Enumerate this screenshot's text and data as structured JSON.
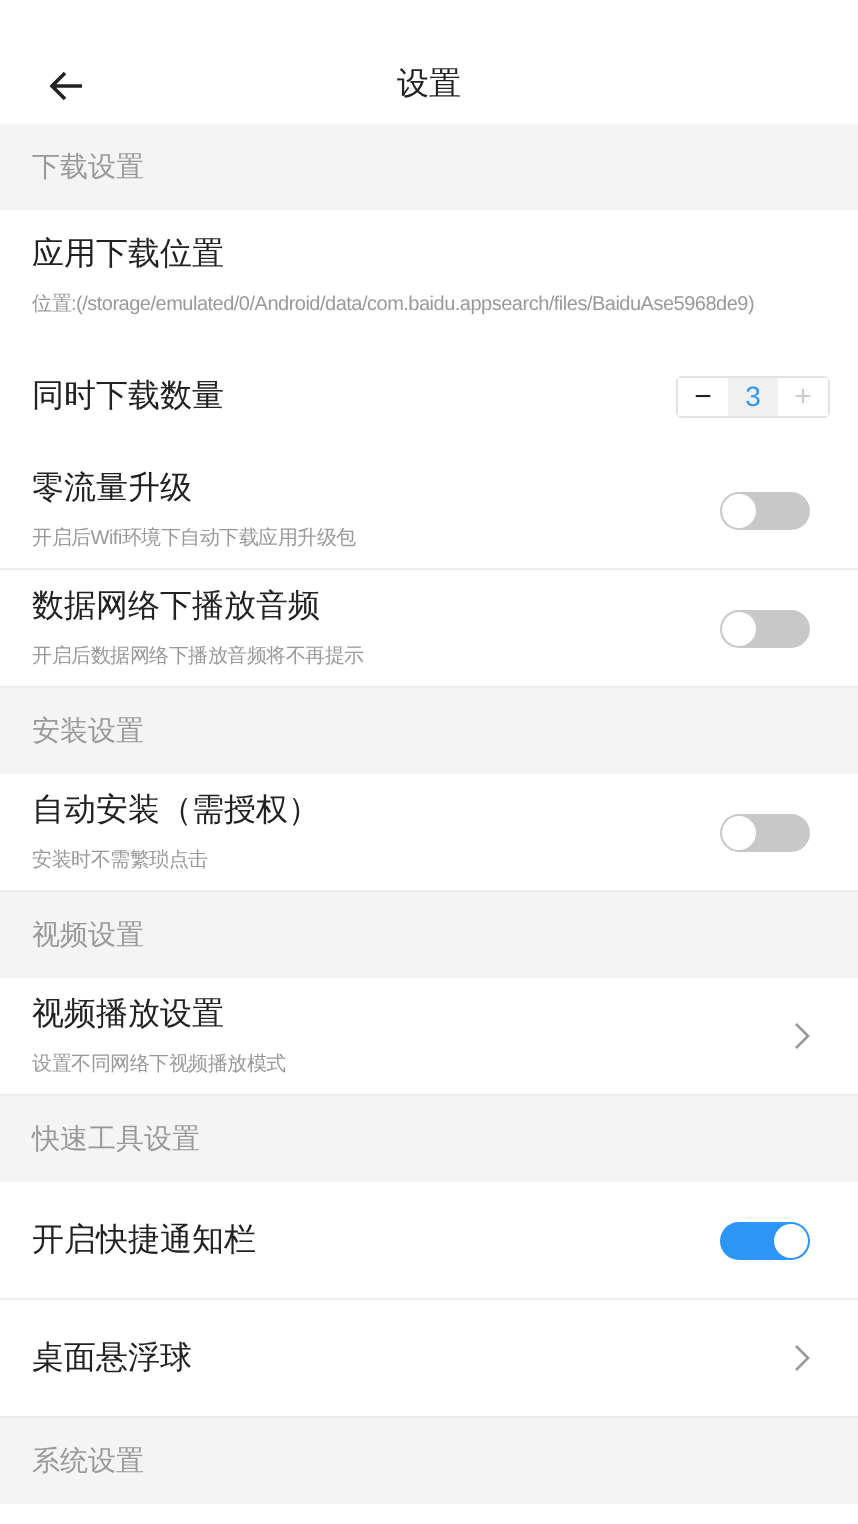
{
  "header": {
    "title": "设置"
  },
  "sections": [
    {
      "title": "下载设置",
      "items": [
        {
          "kind": "info",
          "title": "应用下载位置",
          "subtitle": "位置:(/storage/emulated/0/Android/data/com.baidu.appsearch/files/BaiduAse5968de9)"
        },
        {
          "kind": "stepper",
          "title": "同时下载数量",
          "value": "3",
          "minus": {
            "label": "−",
            "disabled": false
          },
          "plus": {
            "label": "+",
            "disabled": true
          }
        },
        {
          "kind": "toggle",
          "title": "零流量升级",
          "subtitle": "开启后Wifi环境下自动下载应用升级包",
          "on": false
        },
        {
          "kind": "toggle",
          "title": "数据网络下播放音频",
          "subtitle": "开启后数据网络下播放音频将不再提示",
          "on": false
        }
      ]
    },
    {
      "title": "安装设置",
      "items": [
        {
          "kind": "toggle",
          "title": "自动安装（需授权）",
          "subtitle": "安装时不需繁琐点击",
          "on": false
        }
      ]
    },
    {
      "title": "视频设置",
      "items": [
        {
          "kind": "link",
          "title": "视频播放设置",
          "subtitle": "设置不同网络下视频播放模式"
        }
      ]
    },
    {
      "title": "快速工具设置",
      "items": [
        {
          "kind": "toggle",
          "title": "开启快捷通知栏",
          "on": true
        },
        {
          "kind": "link",
          "title": "桌面悬浮球"
        }
      ]
    },
    {
      "title": "系统设置"
    }
  ]
}
